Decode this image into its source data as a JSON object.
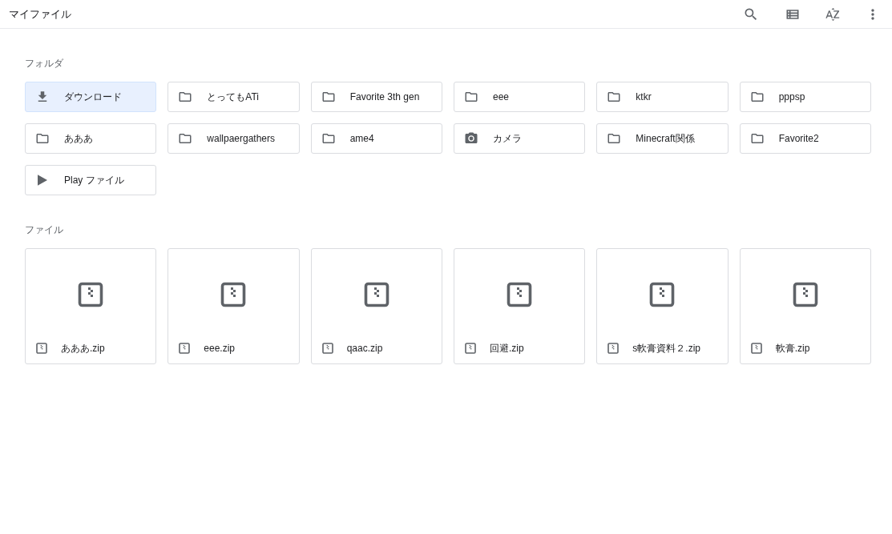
{
  "header": {
    "title": "マイファイル"
  },
  "folders": {
    "heading": "フォルダ",
    "items": [
      {
        "name": "ダウンロード",
        "kind": "download",
        "selected": true
      },
      {
        "name": "とってもATi",
        "kind": "folder",
        "selected": false
      },
      {
        "name": "Favorite 3th gen",
        "kind": "folder",
        "selected": false
      },
      {
        "name": "eee",
        "kind": "folder",
        "selected": false
      },
      {
        "name": "ktkr",
        "kind": "folder",
        "selected": false
      },
      {
        "name": "pppsp",
        "kind": "folder",
        "selected": false
      },
      {
        "name": "あああ",
        "kind": "folder",
        "selected": false
      },
      {
        "name": "wallpaergathers",
        "kind": "folder",
        "selected": false
      },
      {
        "name": "ame4",
        "kind": "folder",
        "selected": false
      },
      {
        "name": "カメラ",
        "kind": "camera",
        "selected": false
      },
      {
        "name": "Minecraft関係",
        "kind": "folder",
        "selected": false
      },
      {
        "name": "Favorite2",
        "kind": "folder",
        "selected": false
      },
      {
        "name": "Play ファイル",
        "kind": "play",
        "selected": false
      }
    ]
  },
  "files": {
    "heading": "ファイル",
    "items": [
      {
        "name": "あああ.zip"
      },
      {
        "name": "eee.zip"
      },
      {
        "name": "qaac.zip"
      },
      {
        "name": "回避.zip"
      },
      {
        "name": "s軟膏資料２.zip"
      },
      {
        "name": "軟膏.zip"
      }
    ]
  }
}
